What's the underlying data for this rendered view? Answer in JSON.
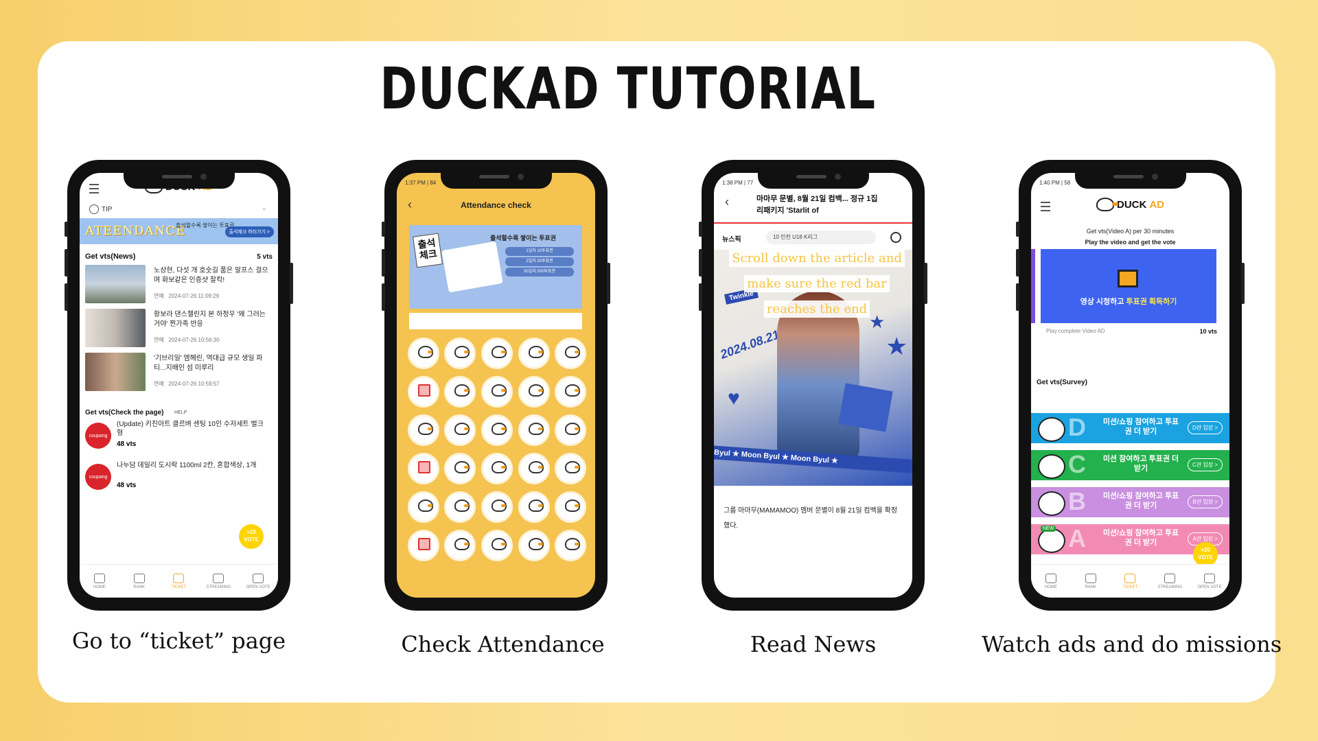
{
  "title": "DUCKAD TUTORIAL",
  "captions": [
    "Go to “ticket” page",
    "Check Attendance",
    "Read News",
    "Watch ads and do missions"
  ],
  "phone1": {
    "brand": "DUCK",
    "brand_ad": "AD",
    "tip": "TIP",
    "banner_title": "ATEENDANCE",
    "banner_sub": "출석할수록 쌓이는 투표권",
    "banner_button": "출석체크 하러가기 >",
    "news_section": "Get vts(News)",
    "news_vts": "5  vts",
    "news": [
      {
        "text": "노상현, 다섯 개 호숫길 품은 알프스 걸으며 화보같은 인증샷 찰칵!",
        "cat": "연예",
        "time": "2024-07-26 11:09:29"
      },
      {
        "text": "황보라 댄스챌린지 본 하정우 '왜 그러는거야' 찐가족 반응",
        "cat": "연예",
        "time": "2024-07-26 10:56:30"
      },
      {
        "text": "'기브리일' 엠헤린, 역대급 규모 생일 파티...지배인 섬 미루리",
        "cat": "연예",
        "time": "2024-07-26 10:59:57"
      }
    ],
    "page_section": "Get vts(Check the page)",
    "page_help": "HELP",
    "coupang": [
      {
        "logo": "coupang",
        "text": "(Update) 키친아트 클르벼 센팅 10인 수저세트 벌크형",
        "vts": "48  vts"
      },
      {
        "logo": "coupang",
        "text": "나누담 데일리 도시락 1100ml 2칸, 혼합색상, 1개",
        "vts": "48  vts"
      }
    ],
    "vote_badge": "+20 VOTE",
    "tabs": [
      "HOME",
      "RANK",
      "TICKET",
      "STREAMING",
      "OPEN VOTE"
    ]
  },
  "phone2": {
    "status_left": "1:37 PM | 84",
    "header": "Attendance check",
    "tag": "출석 체크",
    "banner_title": "출석할수록 쌓이는 투표권",
    "table": [
      "1일차 10투표권",
      "2일차 20투표권",
      "30일차 500투표권"
    ]
  },
  "phone3": {
    "status_left": "1:38 PM | 77",
    "headline": "마마무 문별, 8월 21일 컴백... 정규 1집 리패키지 'Starlit of",
    "source": "뉴스픽",
    "search": "10 인천 U18 K리그",
    "twinkle": "Twinkle",
    "date": "2024.08.21 WED",
    "strip": "n Byul ★ Moon Byul ★ Moon Byul ★",
    "body": "그룹 마마무(MAMAMOO) 멤버 문별이 8월 21일 컴백을 확정했다.",
    "overlay": [
      "Scroll down the article and",
      "make sure the red bar",
      "reaches the end"
    ]
  },
  "phone4": {
    "status_left": "1:40 PM | 58",
    "brand": "DUCK",
    "brand_ad": "AD",
    "line1": "Get vts(Video A) per 30 minutes",
    "line2": "Play the video and get the vote",
    "video_text_a": "영상 시청하고 ",
    "video_text_b": "투표권 획득하기",
    "play_label": "Play complete Video AD",
    "play_vts": "10 vts",
    "survey_section": "Get vts(Survey)",
    "missions": [
      {
        "letter": "D",
        "text": "미션/쇼핑 참여하고 투표권 더 받기",
        "btn": "D관 입장 >",
        "color": "#1aa3e0"
      },
      {
        "letter": "C",
        "text": "미션 참여하고 투표권 더 받기",
        "btn": "C관 입장 >",
        "color": "#22b14c"
      },
      {
        "letter": "B",
        "text": "미션/쇼핑 참여하고 투표권 더 받기",
        "btn": "B관 입장 >",
        "color": "#c98fe0"
      },
      {
        "letter": "A",
        "text": "미션/쇼핑 참여하고 투표권 더 받기",
        "btn": "A관 입장 >",
        "color": "#f28bb3"
      }
    ],
    "new_tag": "NEW",
    "vote_badge": "+20 VOTE",
    "tabs": [
      "HOME",
      "RANK",
      "TICKET",
      "STREAMING",
      "OPEN VOTE"
    ]
  }
}
